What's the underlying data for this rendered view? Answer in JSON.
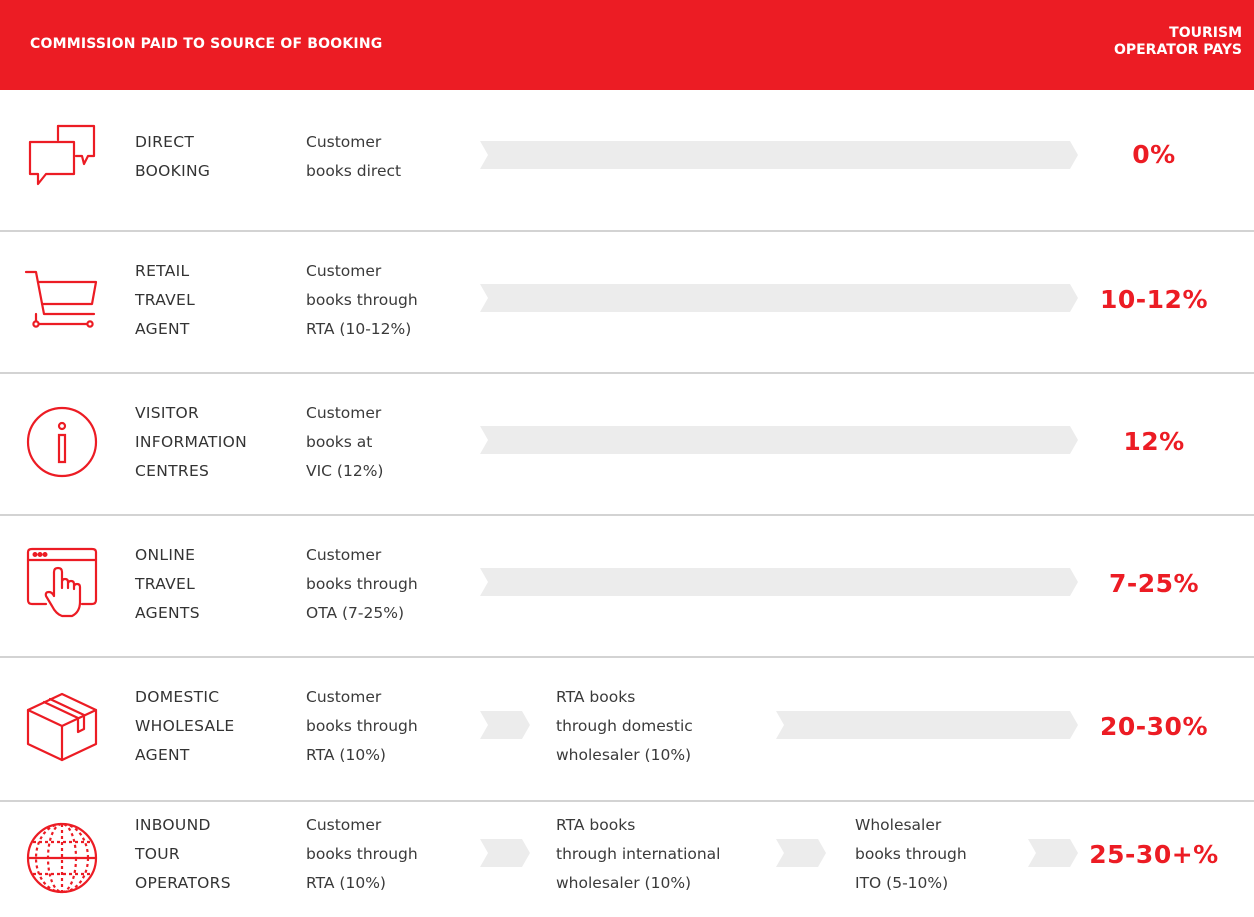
{
  "header": {
    "title": "COMMISSION PAID TO SOURCE OF BOOKING",
    "pays_line1": "TOURISM",
    "pays_line2": "OPERATOR PAYS"
  },
  "accent_color": "#ec1c24",
  "arrow_color": "#ececec",
  "rows": [
    {
      "icon": "chat-bubbles-icon",
      "source": [
        "DIRECT",
        "BOOKING"
      ],
      "steps": [
        [
          "Customer",
          "books direct"
        ]
      ],
      "percent": "0%"
    },
    {
      "icon": "shopping-cart-icon",
      "source": [
        "RETAIL",
        "TRAVEL",
        "AGENT"
      ],
      "steps": [
        [
          "Customer",
          "books through",
          "RTA (10-12%)"
        ]
      ],
      "percent": "10-12%"
    },
    {
      "icon": "info-icon",
      "source": [
        "VISITOR",
        "INFORMATION",
        "CENTRES"
      ],
      "steps": [
        [
          "Customer",
          "books at",
          "VIC (12%)"
        ]
      ],
      "percent": "12%"
    },
    {
      "icon": "browser-click-icon",
      "source": [
        "ONLINE",
        "TRAVEL",
        "AGENTS"
      ],
      "steps": [
        [
          "Customer",
          "books through",
          "OTA (7-25%)"
        ]
      ],
      "percent": "7-25%"
    },
    {
      "icon": "package-box-icon",
      "source": [
        "DOMESTIC",
        "WHOLESALE",
        "AGENT"
      ],
      "steps": [
        [
          "Customer",
          "books through",
          "RTA (10%)"
        ],
        [
          "RTA books",
          "through domestic",
          "wholesaler (10%)"
        ]
      ],
      "percent": "20-30%"
    },
    {
      "icon": "globe-icon",
      "source": [
        "INBOUND",
        "TOUR",
        "OPERATORS"
      ],
      "steps": [
        [
          "Customer",
          "books through",
          "RTA (10%)"
        ],
        [
          "RTA books",
          "through international",
          "wholesaler (10%)"
        ],
        [
          "Wholesaler",
          "books through",
          "ITO (5-10%)"
        ]
      ],
      "percent": "25-30+%"
    }
  ]
}
